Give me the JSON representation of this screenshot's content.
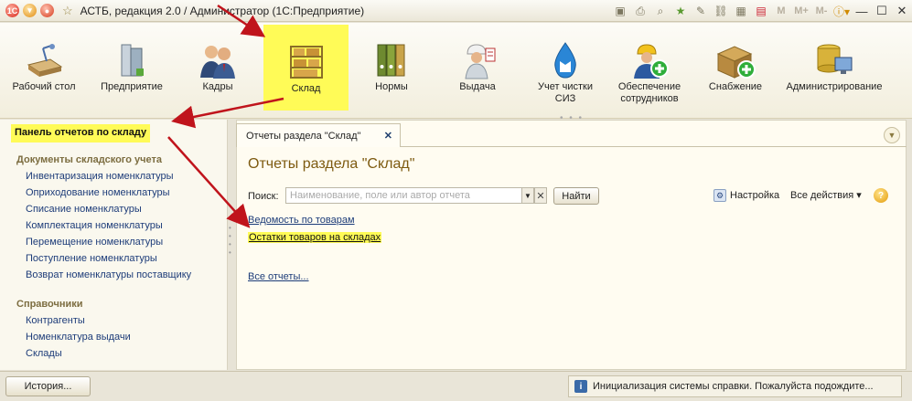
{
  "window": {
    "title": "АСТБ, редакция 2.0 / Администратор  (1С:Предприятие)",
    "mplus": [
      "M",
      "M+",
      "M-"
    ]
  },
  "sections": [
    {
      "label": "Рабочий стол",
      "icon": "desk-icon"
    },
    {
      "label": "Предприятие",
      "icon": "building-icon"
    },
    {
      "label": "Кадры",
      "icon": "people-icon"
    },
    {
      "label": "Склад",
      "icon": "warehouse-shelf-icon",
      "active": true
    },
    {
      "label": "Нормы",
      "icon": "binders-icon"
    },
    {
      "label": "Выдача",
      "icon": "worker-icon"
    },
    {
      "label": "Учет чистки СИЗ",
      "icon": "water-drop-icon"
    },
    {
      "label": "Обеспечение сотрудников",
      "icon": "worker-add-icon"
    },
    {
      "label": "Снабжение",
      "icon": "box-add-icon"
    },
    {
      "label": "Администрирование",
      "icon": "database-monitor-icon"
    }
  ],
  "left_panel": {
    "header": "Панель отчетов по складу",
    "groups": [
      {
        "title": "Документы складского учета",
        "items": [
          "Инвентаризация номенклатуры",
          "Оприходование номенклатуры",
          "Списание номенклатуры",
          "Комплектация номенклатуры",
          "Перемещение номенклатуры",
          "Поступление номенклатуры",
          "Возврат номенклатуры поставщику"
        ]
      },
      {
        "title": "Справочники",
        "items": [
          "Контрагенты",
          "Номенклатура выдачи",
          "Склады"
        ]
      }
    ]
  },
  "main": {
    "tab_label": "Отчеты раздела \"Склад\"",
    "page_title": "Отчеты раздела \"Склад\"",
    "search_label": "Поиск:",
    "search_placeholder": "Наименование, поле или автор отчета",
    "find_button": "Найти",
    "settings_label": "Настройка",
    "all_actions_label": "Все действия",
    "help_label": "?",
    "reports": [
      "Ведомость по товарам",
      "Остатки товаров на складах"
    ],
    "all_reports_link": "Все отчеты..."
  },
  "statusbar": {
    "history_button": "История...",
    "message": "Инициализация системы справки. Пожалуйста подождите..."
  },
  "colors": {
    "highlight": "#fffb57",
    "arrow": "#c0141c",
    "link": "#1d3c79",
    "title": "#7d5a10"
  }
}
